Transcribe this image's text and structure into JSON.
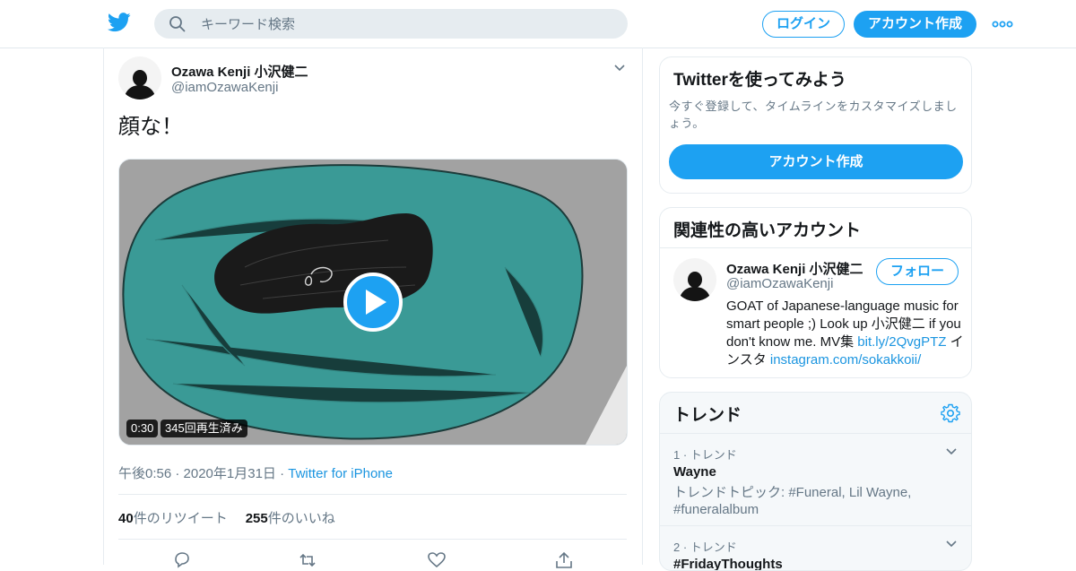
{
  "header": {
    "search_placeholder": "キーワード検索",
    "login_label": "ログイン",
    "signup_label": "アカウント作成"
  },
  "tweet": {
    "author_name": "Ozawa Kenji 小沢健二",
    "author_handle": "@iamOzawaKenji",
    "text": "顔な！",
    "video_duration": "0:30",
    "video_views": "345回再生済み",
    "timestamp": "午後0:56 · 2020年1月31日 · ",
    "source": "Twitter for iPhone",
    "retweet_count": "40",
    "retweet_label": "件のリツイート",
    "like_count": "255",
    "like_label": "件のいいね"
  },
  "signup_card": {
    "title": "Twitterを使ってみよう",
    "description": "今すぐ登録して、タイムラインをカスタマイズしましょう。",
    "button_label": "アカウント作成"
  },
  "related": {
    "title": "関連性の高いアカウント",
    "name": "Ozawa Kenji 小沢健二",
    "handle": "@iamOzawaKenji",
    "follow_label": "フォロー",
    "bio_text": "GOAT of Japanese-language music for smart people ;) Look up 小沢健二 if you don't know me. MV集 ",
    "bio_link1": "bit.ly/2QvgPTZ",
    "bio_mid": " インスタ ",
    "bio_link2": "instagram.com/sokakkoii/"
  },
  "trends": {
    "title": "トレンド",
    "items": [
      {
        "meta": "1 · トレンド",
        "name": "Wayne",
        "topic": "トレンドトピック: #Funeral, Lil Wayne, #funeralalbum"
      },
      {
        "meta": "2 · トレンド",
        "name": "#FridayThoughts",
        "topic": ""
      }
    ]
  },
  "colors": {
    "accent": "#1da1f2",
    "link": "#1b95e0",
    "secondary_text": "#657786",
    "video_teal": "#3a9a96"
  }
}
